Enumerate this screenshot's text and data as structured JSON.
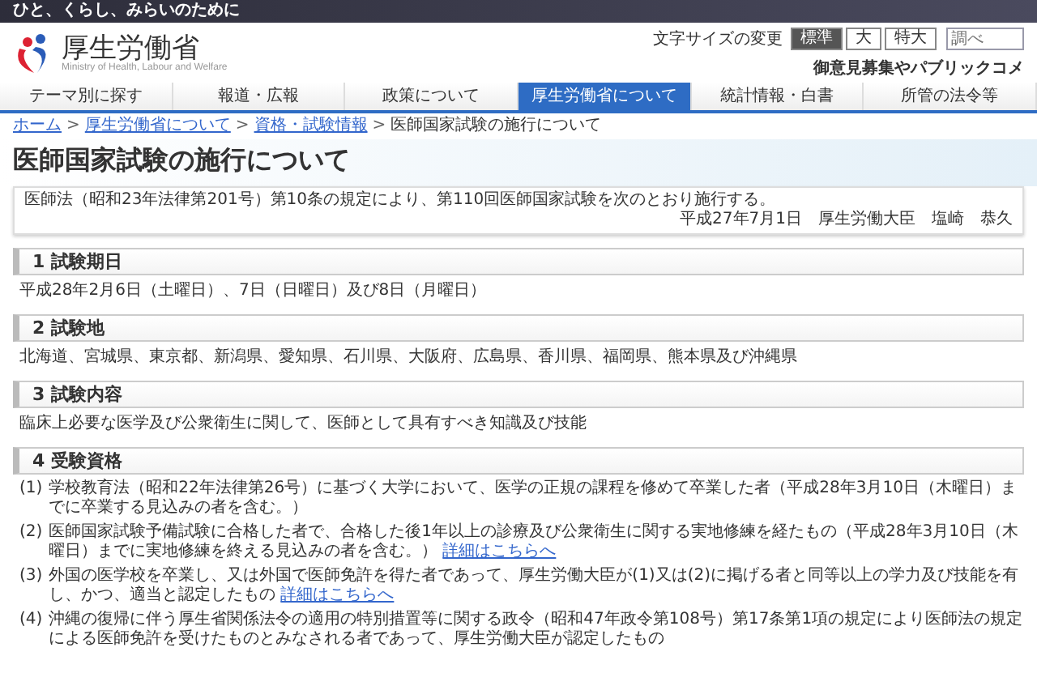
{
  "tagline": "ひと、くらし、みらいのために",
  "logo": {
    "name": "厚生労働省",
    "subtitle": "Ministry of Health, Labour and Welfare"
  },
  "text_size": {
    "label": "文字サイズの変更",
    "options": [
      {
        "label": "標準",
        "selected": true
      },
      {
        "label": "大",
        "selected": false
      },
      {
        "label": "特大",
        "selected": false
      }
    ]
  },
  "search": {
    "placeholder": "調べ"
  },
  "header_link": "御意見募集やパブリックコメ",
  "nav": [
    {
      "label": "テーマ別に探す",
      "selected": false
    },
    {
      "label": "報道・広報",
      "selected": false
    },
    {
      "label": "政策について",
      "selected": false
    },
    {
      "label": "厚生労働省について",
      "selected": true
    },
    {
      "label": "統計情報・白書",
      "selected": false
    },
    {
      "label": "所管の法令等",
      "selected": false
    }
  ],
  "breadcrumb": [
    {
      "label": "ホーム",
      "link": true
    },
    {
      "separator": ">",
      "label": "厚生労働省について",
      "link": true
    },
    {
      "separator": ">",
      "label": "資格・試験情報",
      "link": true
    },
    {
      "separator": ">",
      "label": "医師国家試験の施行について",
      "link": false
    }
  ],
  "title": "医師国家試験の施行について",
  "intro": {
    "text": "医師法（昭和23年法律第201号）第10条の規定により、第110回医師国家試験を次のとおり施行する。",
    "signature": "平成27年7月1日　厚生労働大臣　塩崎　恭久"
  },
  "sections": [
    {
      "heading": "1 試験期日",
      "text": "平成28年2月6日（土曜日）、7日（日曜日）及び8日（月曜日）"
    },
    {
      "heading": "2 試験地",
      "text": "北海道、宮城県、東京都、新潟県、愛知県、石川県、大阪府、広島県、香川県、福岡県、熊本県及び沖縄県"
    },
    {
      "heading": "3 試験内容",
      "text": "臨床上必要な医学及び公衆衛生に関して、医師として具有すべき知識及び技能"
    },
    {
      "heading": "4 受験資格",
      "items": [
        {
          "number": "(1)",
          "text": "学校教育法（昭和22年法律第26号）に基づく大学において、医学の正規の課程を修めて卒業した者（平成28年3月10日（木曜日）までに卒業する見込みの者を含む。）"
        },
        {
          "number": "(2)",
          "text": "医師国家試験予備試験に合格した者で、合格した後1年以上の診療及び公衆衛生に関する実地修練を経たもの（平成28年3月10日（木曜日）までに実地修練を終える見込みの者を含む。）",
          "link": "詳細はこちらへ"
        },
        {
          "number": "(3)",
          "text": "外国の医学校を卒業し、又は外国で医師免許を得た者であって、厚生労働大臣が(1)又は(2)に掲げる者と同等以上の学力及び技能を有し、かつ、適当と認定したもの",
          "link": "詳細はこちらへ"
        },
        {
          "number": "(4)",
          "text": "沖縄の復帰に伴う厚生省関係法令の適用の特別措置等に関する政令（昭和47年政令第108号）第17条第1項の規定により医師法の規定による医師免許を受けたものとみなされる者であって、厚生労働大臣が認定したもの"
        }
      ]
    }
  ]
}
